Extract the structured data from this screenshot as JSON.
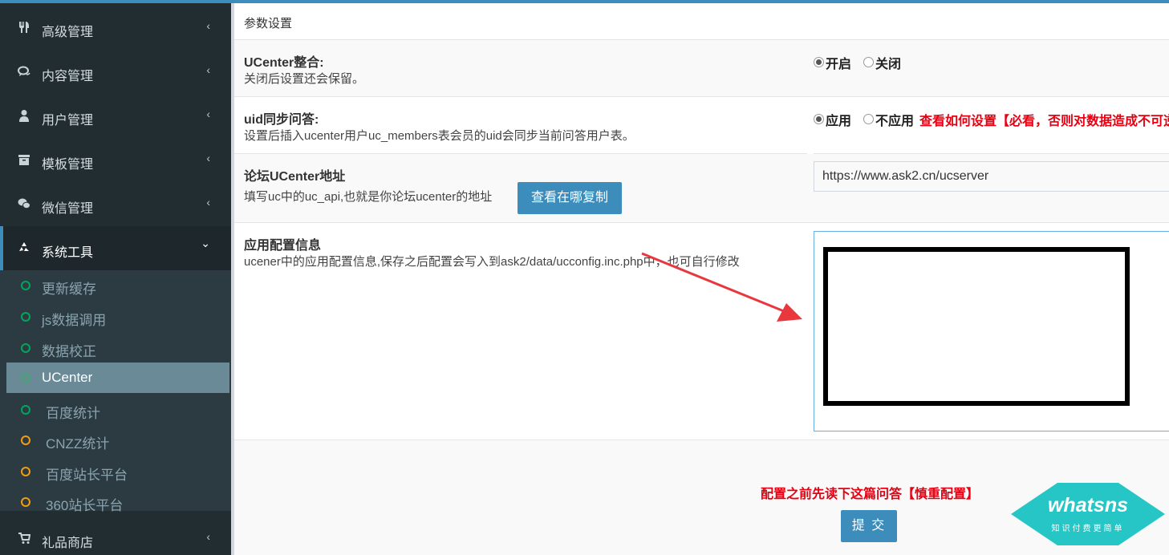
{
  "sidebar": {
    "menu": [
      {
        "label": "高级管理",
        "icon": "cutlery-icon"
      },
      {
        "label": "内容管理",
        "icon": "chat-icon"
      },
      {
        "label": "用户管理",
        "icon": "user-icon"
      },
      {
        "label": "模板管理",
        "icon": "archive-icon"
      },
      {
        "label": "微信管理",
        "icon": "wechat-icon"
      },
      {
        "label": "系统工具",
        "icon": "recycle-icon"
      }
    ],
    "submenu": [
      {
        "label": "更新缓存"
      },
      {
        "label": "js数据调用"
      },
      {
        "label": "数据校正"
      },
      {
        "label": "UCenter"
      },
      {
        "label": "百度统计"
      },
      {
        "label": "CNZZ统计"
      },
      {
        "label": "百度站长平台"
      },
      {
        "label": "360站长平台"
      }
    ],
    "shop": {
      "label": "礼品商店",
      "icon": "cart-icon"
    },
    "chev_closed": "‹",
    "chev_open": "⌄"
  },
  "main": {
    "title": "参数设置",
    "ucenter_integration": {
      "title": "UCenter整合:",
      "desc": "关闭后设置还会保留。",
      "opt_on": "开启",
      "opt_off": "关闭",
      "selected": "开启"
    },
    "uid_sync": {
      "title": "uid同步问答:",
      "desc": "设置后插入ucenter用户uc_members表会员的uid会同步当前问答用户表。",
      "opt_on": "应用",
      "opt_off": "不应用",
      "selected": "应用",
      "warning": "查看如何设置【必看，否则对数据造成不可逆"
    },
    "forum_url": {
      "title": "论坛UCenter地址",
      "desc": "填写uc中的uc_api,也就是你论坛ucenter的地址",
      "copy_button": "查看在哪复制",
      "value": "https://www.ask2.cn/ucserver"
    },
    "app_config": {
      "title": "应用配置信息",
      "desc": "ucener中的应用配置信息,保存之后配置会写入到ask2/data/ucconfig.inc.php中，也可自行修改"
    },
    "note": "配置之前先读下这篇问答【慎重配置】",
    "submit": "提 交",
    "logo": {
      "brand": "whatsns",
      "tagline": "知识付费更简单"
    }
  },
  "colors": {
    "accent": "#3c8dbc",
    "sidebar": "#222d32",
    "warning": "#e60012",
    "logo": "#26c6c6"
  }
}
